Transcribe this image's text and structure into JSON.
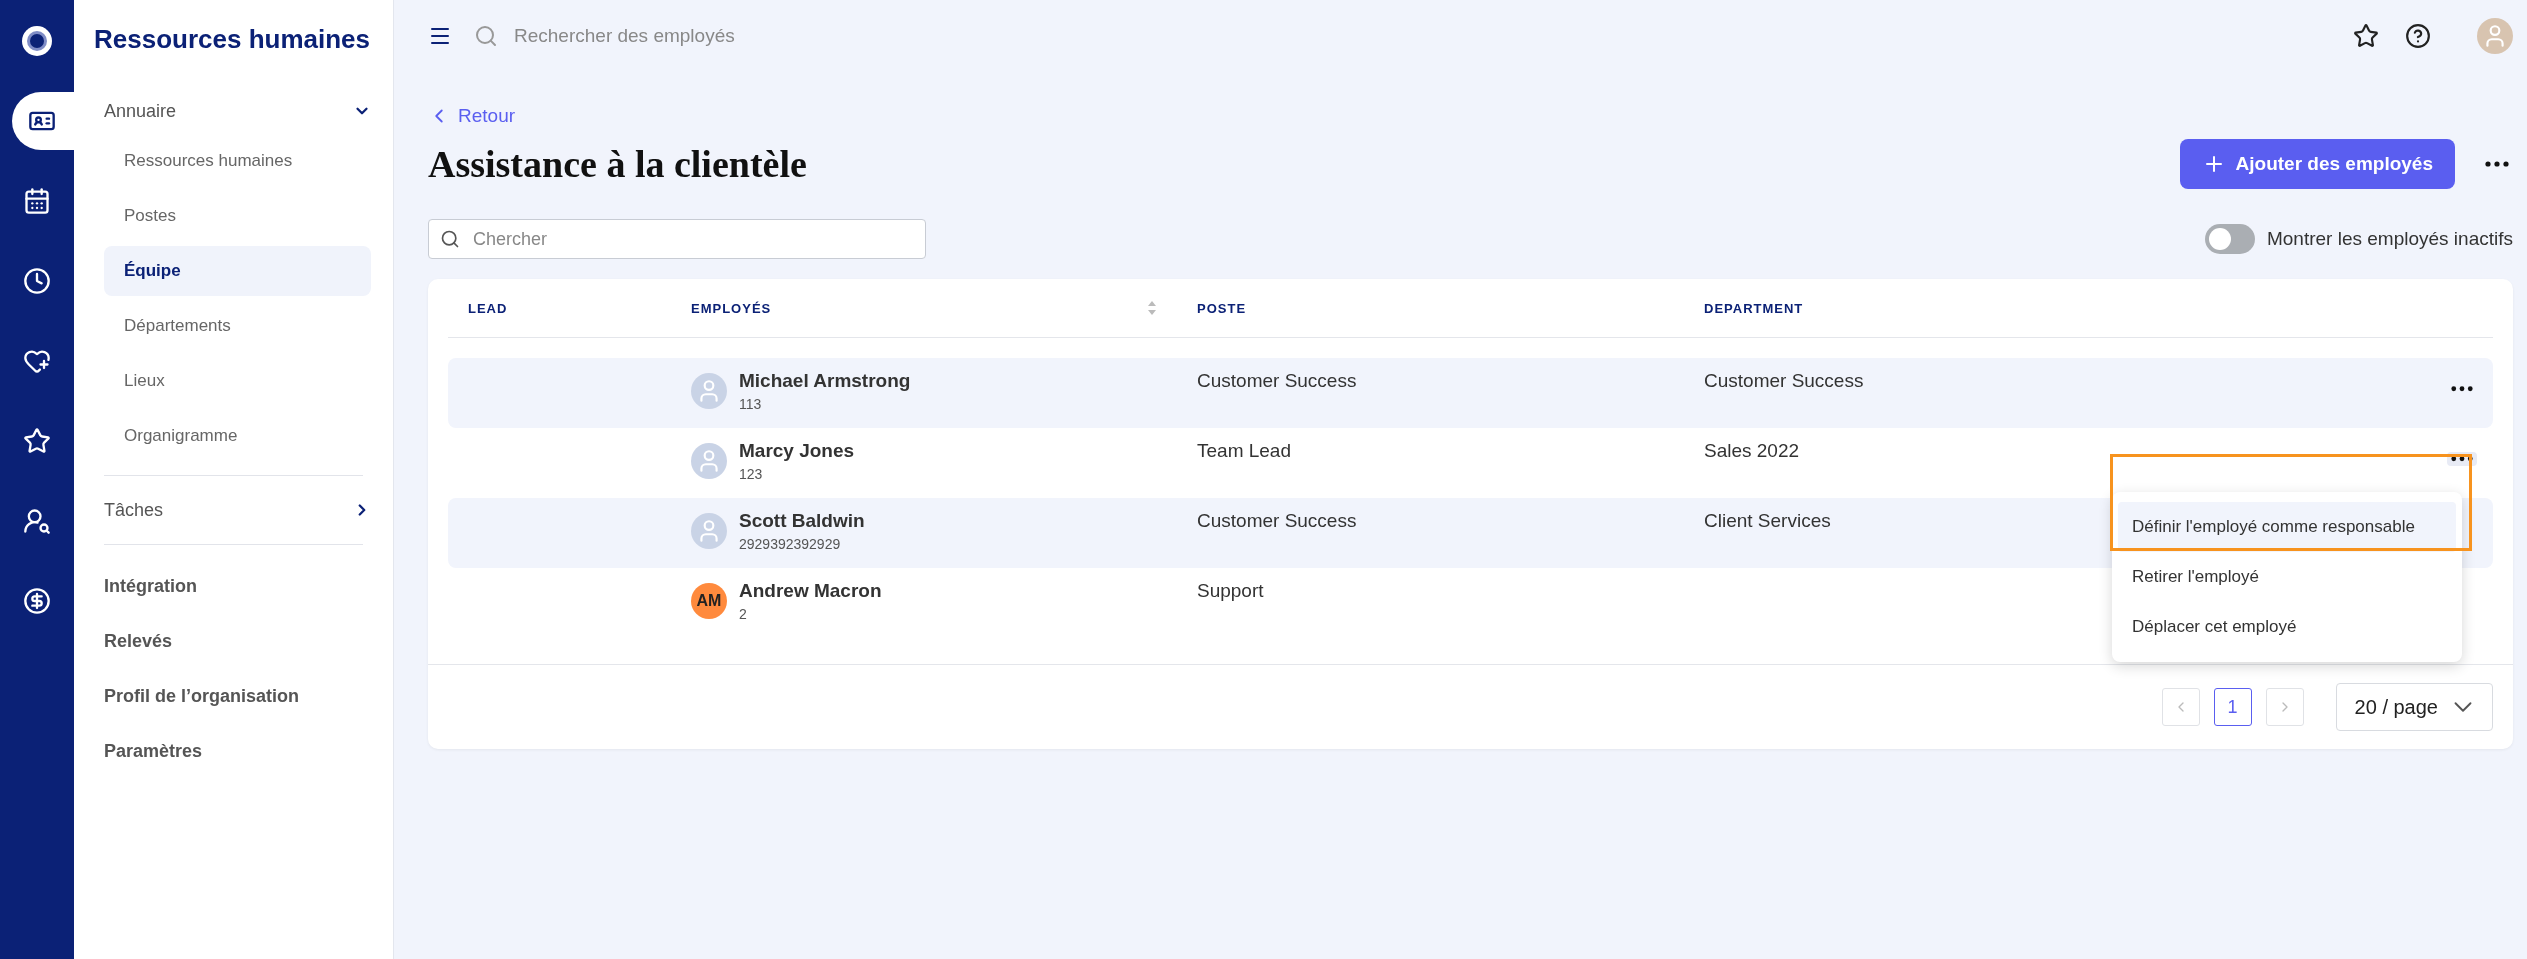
{
  "rail": [
    {
      "kind": "logo",
      "selected": false
    },
    {
      "kind": "directory",
      "selected": true
    },
    {
      "kind": "calendar",
      "selected": false
    },
    {
      "kind": "clock",
      "selected": false
    },
    {
      "kind": "health",
      "selected": false
    },
    {
      "kind": "star",
      "selected": false
    },
    {
      "kind": "recruit",
      "selected": false
    },
    {
      "kind": "payroll",
      "selected": false
    }
  ],
  "sidebar": {
    "title": "Ressources humaines",
    "nav": [
      {
        "kind": "group",
        "label": "Annuaire",
        "expanded": true,
        "children": [
          {
            "label": "Ressources humaines",
            "selected": false
          },
          {
            "label": "Postes",
            "selected": false
          },
          {
            "label": "Équipe",
            "selected": true
          },
          {
            "label": "Départements",
            "selected": false
          },
          {
            "label": "Lieux",
            "selected": false
          },
          {
            "label": "Organigramme",
            "selected": false
          }
        ]
      },
      {
        "kind": "group",
        "label": "Tâches",
        "expanded": false
      },
      {
        "kind": "link",
        "label": "Intégration"
      },
      {
        "kind": "link",
        "label": "Relevés"
      },
      {
        "kind": "link",
        "label": "Profil de l’organisation"
      },
      {
        "kind": "link",
        "label": "Paramètres"
      }
    ]
  },
  "topbar": {
    "search_placeholder": "Rechercher des employés"
  },
  "back_link": "Retour",
  "page_title": "Assistance à la clientèle",
  "add_button": "Ajouter des employés",
  "filter": {
    "placeholder": "Chercher"
  },
  "inactive_toggle": {
    "label": "Montrer les employés inactifs",
    "on": false
  },
  "table": {
    "columns": [
      {
        "label": "LEAD",
        "sortable": false
      },
      {
        "label": "EMPLOYÉS",
        "sortable": true
      },
      {
        "label": "POSTE",
        "sortable": false
      },
      {
        "label": "DEPARTMENT",
        "sortable": false
      }
    ],
    "rows": [
      {
        "name": "Michael Armstrong",
        "id": "113",
        "avatar": {
          "kind": "photo"
        },
        "position": "Customer Success",
        "department": "Customer Success",
        "actions_visible": true,
        "menu_open": false
      },
      {
        "name": "Marcy Jones",
        "id": "123",
        "avatar": {
          "kind": "photo"
        },
        "position": "Team Lead",
        "department": "Sales 2022",
        "actions_visible": true,
        "menu_open": true
      },
      {
        "name": "Scott Baldwin",
        "id": "2929392392929",
        "avatar": {
          "kind": "photo"
        },
        "position": "Customer Success",
        "department": "Client Services",
        "actions_visible": false,
        "menu_open": false
      },
      {
        "name": "Andrew Macron",
        "id": "2",
        "avatar": {
          "kind": "initials",
          "initials": "AM",
          "color": "#ff8a3d"
        },
        "position": "Support",
        "actions_visible": false,
        "menu_open": false
      }
    ]
  },
  "row_menu": {
    "items": [
      {
        "label": "Définir l'employé comme responsable",
        "highlighted": true
      },
      {
        "label": "Retirer l'employé",
        "highlighted": false
      },
      {
        "label": "Déplacer cet employé",
        "highlighted": false
      }
    ]
  },
  "pagination": {
    "pages": [
      {
        "label": "1",
        "selected": true
      }
    ],
    "page_size": "20 / page"
  }
}
